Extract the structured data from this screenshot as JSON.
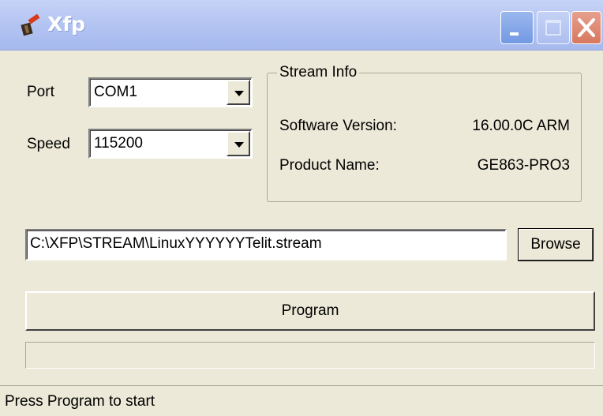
{
  "window": {
    "title": "Xfp",
    "icon": "hammer-app-icon",
    "controls": [
      "minimize-icon",
      "maximize-icon",
      "close-icon"
    ]
  },
  "port": {
    "label": "Port",
    "value": "COM1"
  },
  "speed": {
    "label": "Speed",
    "value": "115200"
  },
  "stream_info": {
    "title": "Stream Info",
    "software_version_label": "Software Version:",
    "software_version_value": "16.00.0C ARM",
    "product_name_label": "Product Name:",
    "product_name_value": "GE863-PRO3"
  },
  "file": {
    "path": "C:\\XFP\\STREAM\\LinuxYYYYYYTelit.stream",
    "browse_label": "Browse"
  },
  "program": {
    "label": "Program"
  },
  "progress": {
    "percent": 0
  },
  "status": {
    "text": "Press Program to start"
  },
  "colors": {
    "face": "#ece9d8",
    "titlebar": "#b3c4f2",
    "close_button": "#d7785e",
    "progress_fill": "#3168d5"
  }
}
